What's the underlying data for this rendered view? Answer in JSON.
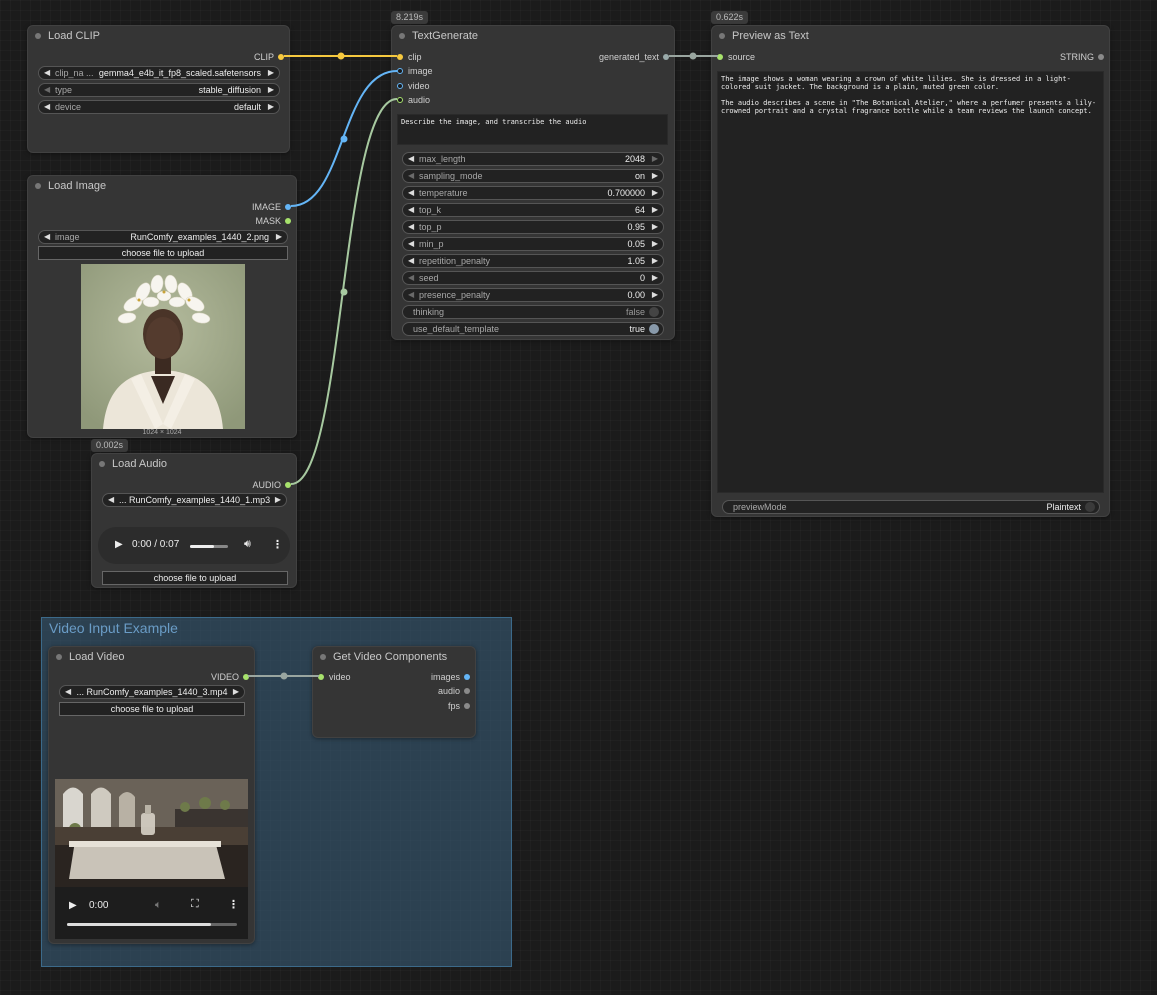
{
  "nodes": {
    "load_clip": {
      "title": "Load CLIP",
      "output": "CLIP",
      "widgets": [
        {
          "label": "clip_na ...",
          "value": "gemma4_e4b_it_fp8_scaled.safetensors"
        },
        {
          "label": "type",
          "value": "stable_diffusion"
        },
        {
          "label": "device",
          "value": "default"
        }
      ]
    },
    "load_image": {
      "title": "Load Image",
      "outputs": [
        "IMAGE",
        "MASK"
      ],
      "image_widget": {
        "label": "image",
        "value": "RunComfy_examples_1440_2.png"
      },
      "upload_label": "choose file to upload",
      "caption": "1024 × 1024"
    },
    "load_audio": {
      "badge": "0.002s",
      "title": "Load Audio",
      "output": "AUDIO",
      "file": "... RunComfy_examples_1440_1.mp3",
      "player_time": "0:00 / 0:07",
      "upload_label": "choose file to upload"
    },
    "text_generate": {
      "badge": "8.219s",
      "title": "TextGenerate",
      "inputs": [
        "clip",
        "image",
        "video",
        "audio"
      ],
      "output": "generated_text",
      "prompt": "Describe the image, and transcribe the audio",
      "widgets": [
        {
          "label": "max_length",
          "value": "2048"
        },
        {
          "label": "sampling_mode",
          "value": "on"
        },
        {
          "label": "temperature",
          "value": "0.700000"
        },
        {
          "label": "top_k",
          "value": "64"
        },
        {
          "label": "top_p",
          "value": "0.95"
        },
        {
          "label": "min_p",
          "value": "0.05"
        },
        {
          "label": "repetition_penalty",
          "value": "1.05"
        },
        {
          "label": "seed",
          "value": "0"
        },
        {
          "label": "presence_penalty",
          "value": "0.00"
        }
      ],
      "toggles": [
        {
          "label": "thinking",
          "value": "false"
        },
        {
          "label": "use_default_template",
          "value": "true"
        }
      ]
    },
    "preview_text": {
      "badge": "0.622s",
      "title": "Preview as Text",
      "input": "source",
      "output": "STRING",
      "text": "The image shows a woman wearing a crown of white lilies. She is dressed in a light-colored suit jacket. The background is a plain, muted green color.\n\nThe audio describes a scene in \"The Botanical Atelier,\" where a perfumer presents a lily-crowned portrait and a crystal fragrance bottle while a team reviews the launch concept.",
      "preview_mode_label": "previewMode",
      "preview_mode_value": "Plaintext"
    },
    "load_video": {
      "title": "Load Video",
      "output": "VIDEO",
      "file": "... RunComfy_examples_1440_3.mp4",
      "upload_label": "choose file to upload",
      "player_time": "0:00"
    },
    "get_video_components": {
      "title": "Get Video Components",
      "input": "video",
      "outputs": [
        "images",
        "audio",
        "fps"
      ]
    }
  },
  "group": {
    "title": "Video Input Example"
  },
  "colors": {
    "clip_link": "#f6c93f",
    "image_link": "#64b5f6",
    "audio_link": "#a7c9a0",
    "string_link": "#9aa6a0"
  }
}
